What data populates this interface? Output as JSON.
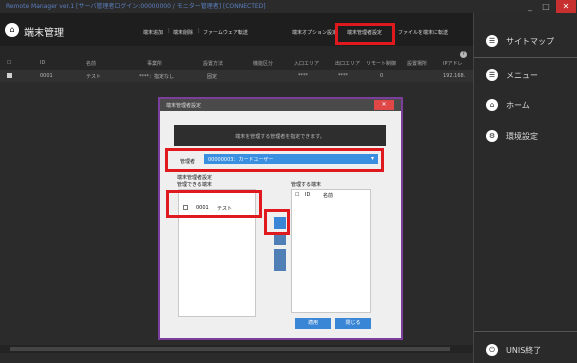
{
  "window": {
    "title": "Remote Manager ver.1 [サーバ管理者ログイン:00000000 / モニター管理者] [CONNECTED]",
    "controls": [
      "_",
      "□",
      "✕"
    ]
  },
  "header": {
    "title": "端末管理",
    "tabs": [
      {
        "label": "端末追加"
      },
      {
        "label": "端末削除"
      },
      {
        "label": "ファームウェア転送"
      },
      {
        "label": "端末オプション設定"
      },
      {
        "label": "端末管理者設定"
      },
      {
        "label": "ファイルを端末に転送"
      }
    ],
    "tab_separator": "|"
  },
  "table": {
    "columns": [
      "ID",
      "名前",
      "事業所",
      "設置方法",
      "機能区分",
      "入口エリア",
      "出口エリア",
      "リモート制御",
      "設置場所",
      "IPアドレ"
    ],
    "rows": [
      {
        "id": "0001",
        "name": "テスト",
        "office": "****：指定なし",
        "install": "固定",
        "func": "",
        "in_area": "****",
        "out_area": "****",
        "remote": "0",
        "place": "",
        "ip": "192.168."
      }
    ]
  },
  "dialog": {
    "title": "端末管理者設定",
    "banner": "端末を管理する管理者を指定できます。",
    "admin_label": "管理者",
    "admin_value": "00000003：カードユーザー",
    "left_section_title": "端末管理者設定",
    "left_list_title": "管理できる端末",
    "left_items": [
      {
        "id": "0001",
        "name": "テスト"
      }
    ],
    "right_list_title": "管理する端末",
    "right_headers": [
      "ID",
      "名前"
    ],
    "right_header_mark": "☐",
    "ok_label": "適用",
    "cancel_label": "閉じる"
  },
  "sidebar": {
    "items": [
      {
        "label": "サイトマップ",
        "icon": "sitemap-icon",
        "glyph": "☰"
      },
      {
        "label": "メニュー",
        "icon": "menu-icon",
        "glyph": "☰"
      },
      {
        "label": "ホーム",
        "icon": "home-icon",
        "glyph": "⌂"
      },
      {
        "label": "環境設定",
        "icon": "settings-icon",
        "glyph": "⚙"
      }
    ],
    "exit_label": "UNIS終了",
    "exit_glyph": "⏻"
  },
  "colors": {
    "highlight": "#e0191e",
    "accent_blue": "#3a86d6",
    "dialog_border": "#7b3e9d"
  }
}
